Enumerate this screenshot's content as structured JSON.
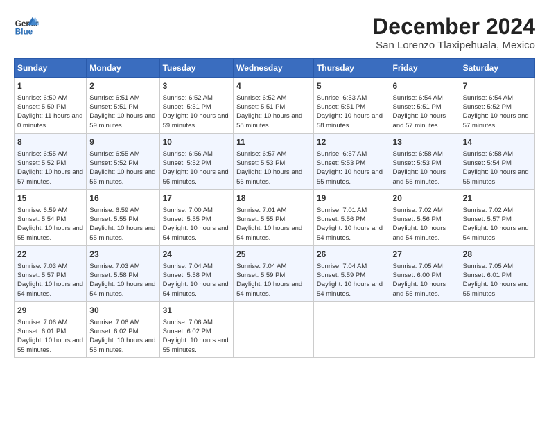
{
  "logo": {
    "line1": "General",
    "line2": "Blue"
  },
  "title": "December 2024",
  "subtitle": "San Lorenzo Tlaxipehuala, Mexico",
  "days_of_week": [
    "Sunday",
    "Monday",
    "Tuesday",
    "Wednesday",
    "Thursday",
    "Friday",
    "Saturday"
  ],
  "weeks": [
    [
      {
        "day": "1",
        "sunrise": "6:50 AM",
        "sunset": "5:50 PM",
        "daylight": "11 hours and 0 minutes."
      },
      {
        "day": "2",
        "sunrise": "6:51 AM",
        "sunset": "5:51 PM",
        "daylight": "10 hours and 59 minutes."
      },
      {
        "day": "3",
        "sunrise": "6:52 AM",
        "sunset": "5:51 PM",
        "daylight": "10 hours and 59 minutes."
      },
      {
        "day": "4",
        "sunrise": "6:52 AM",
        "sunset": "5:51 PM",
        "daylight": "10 hours and 58 minutes."
      },
      {
        "day": "5",
        "sunrise": "6:53 AM",
        "sunset": "5:51 PM",
        "daylight": "10 hours and 58 minutes."
      },
      {
        "day": "6",
        "sunrise": "6:54 AM",
        "sunset": "5:51 PM",
        "daylight": "10 hours and 57 minutes."
      },
      {
        "day": "7",
        "sunrise": "6:54 AM",
        "sunset": "5:52 PM",
        "daylight": "10 hours and 57 minutes."
      }
    ],
    [
      {
        "day": "8",
        "sunrise": "6:55 AM",
        "sunset": "5:52 PM",
        "daylight": "10 hours and 57 minutes."
      },
      {
        "day": "9",
        "sunrise": "6:55 AM",
        "sunset": "5:52 PM",
        "daylight": "10 hours and 56 minutes."
      },
      {
        "day": "10",
        "sunrise": "6:56 AM",
        "sunset": "5:52 PM",
        "daylight": "10 hours and 56 minutes."
      },
      {
        "day": "11",
        "sunrise": "6:57 AM",
        "sunset": "5:53 PM",
        "daylight": "10 hours and 56 minutes."
      },
      {
        "day": "12",
        "sunrise": "6:57 AM",
        "sunset": "5:53 PM",
        "daylight": "10 hours and 55 minutes."
      },
      {
        "day": "13",
        "sunrise": "6:58 AM",
        "sunset": "5:53 PM",
        "daylight": "10 hours and 55 minutes."
      },
      {
        "day": "14",
        "sunrise": "6:58 AM",
        "sunset": "5:54 PM",
        "daylight": "10 hours and 55 minutes."
      }
    ],
    [
      {
        "day": "15",
        "sunrise": "6:59 AM",
        "sunset": "5:54 PM",
        "daylight": "10 hours and 55 minutes."
      },
      {
        "day": "16",
        "sunrise": "6:59 AM",
        "sunset": "5:55 PM",
        "daylight": "10 hours and 55 minutes."
      },
      {
        "day": "17",
        "sunrise": "7:00 AM",
        "sunset": "5:55 PM",
        "daylight": "10 hours and 54 minutes."
      },
      {
        "day": "18",
        "sunrise": "7:01 AM",
        "sunset": "5:55 PM",
        "daylight": "10 hours and 54 minutes."
      },
      {
        "day": "19",
        "sunrise": "7:01 AM",
        "sunset": "5:56 PM",
        "daylight": "10 hours and 54 minutes."
      },
      {
        "day": "20",
        "sunrise": "7:02 AM",
        "sunset": "5:56 PM",
        "daylight": "10 hours and 54 minutes."
      },
      {
        "day": "21",
        "sunrise": "7:02 AM",
        "sunset": "5:57 PM",
        "daylight": "10 hours and 54 minutes."
      }
    ],
    [
      {
        "day": "22",
        "sunrise": "7:03 AM",
        "sunset": "5:57 PM",
        "daylight": "10 hours and 54 minutes."
      },
      {
        "day": "23",
        "sunrise": "7:03 AM",
        "sunset": "5:58 PM",
        "daylight": "10 hours and 54 minutes."
      },
      {
        "day": "24",
        "sunrise": "7:04 AM",
        "sunset": "5:58 PM",
        "daylight": "10 hours and 54 minutes."
      },
      {
        "day": "25",
        "sunrise": "7:04 AM",
        "sunset": "5:59 PM",
        "daylight": "10 hours and 54 minutes."
      },
      {
        "day": "26",
        "sunrise": "7:04 AM",
        "sunset": "5:59 PM",
        "daylight": "10 hours and 54 minutes."
      },
      {
        "day": "27",
        "sunrise": "7:05 AM",
        "sunset": "6:00 PM",
        "daylight": "10 hours and 55 minutes."
      },
      {
        "day": "28",
        "sunrise": "7:05 AM",
        "sunset": "6:01 PM",
        "daylight": "10 hours and 55 minutes."
      }
    ],
    [
      {
        "day": "29",
        "sunrise": "7:06 AM",
        "sunset": "6:01 PM",
        "daylight": "10 hours and 55 minutes."
      },
      {
        "day": "30",
        "sunrise": "7:06 AM",
        "sunset": "6:02 PM",
        "daylight": "10 hours and 55 minutes."
      },
      {
        "day": "31",
        "sunrise": "7:06 AM",
        "sunset": "6:02 PM",
        "daylight": "10 hours and 55 minutes."
      },
      null,
      null,
      null,
      null
    ]
  ]
}
